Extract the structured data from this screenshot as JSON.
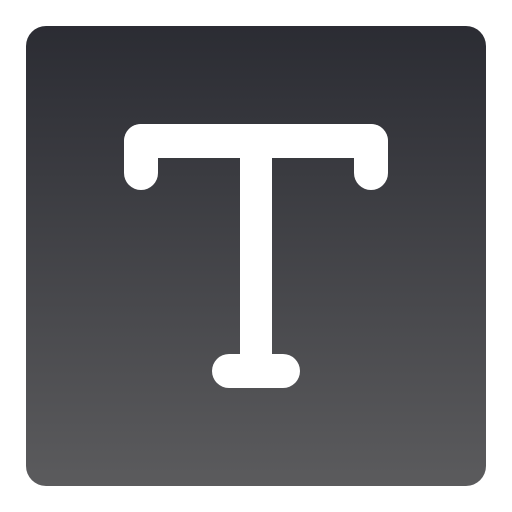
{
  "icon": {
    "name": "text-tool-icon",
    "glyph": "text-t-icon",
    "colors": {
      "gradient_top": "#2b2c33",
      "gradient_bottom": "#5b5b5d",
      "glyph": "#ffffff",
      "page_background": "#ffffff"
    }
  }
}
